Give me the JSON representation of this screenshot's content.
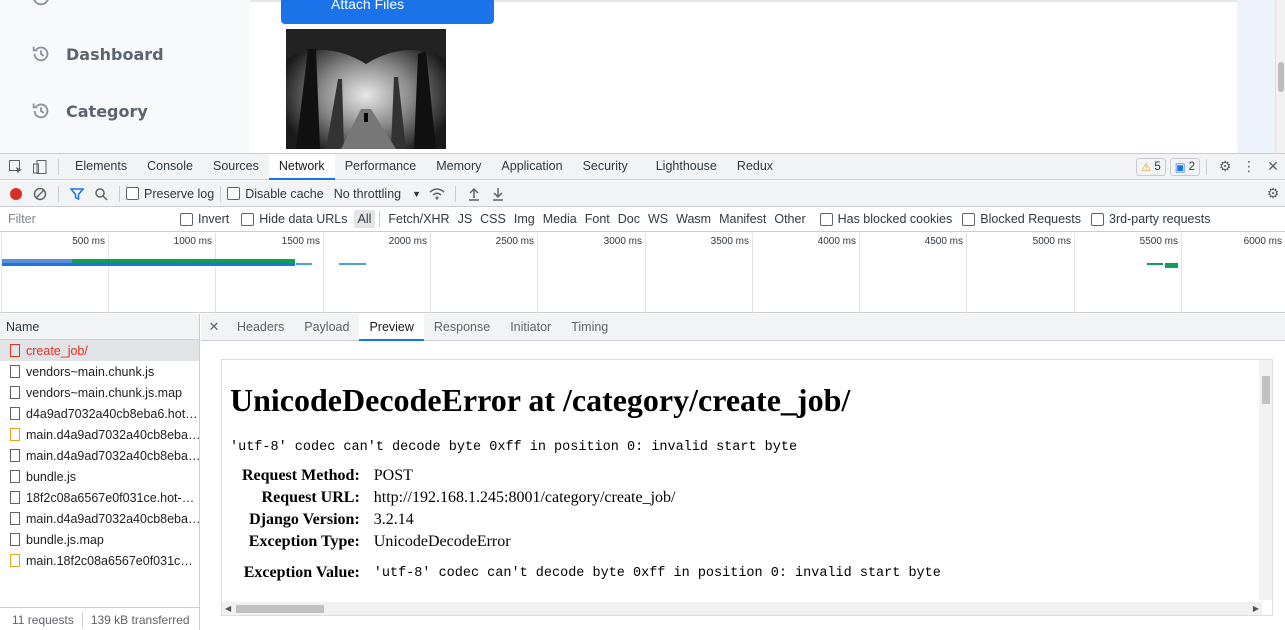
{
  "app": {
    "sidebar": [
      {
        "label": "Dashboard",
        "icon": "history-icon"
      },
      {
        "label": "Category",
        "icon": "history-icon"
      }
    ],
    "attach_label": "Attach Files"
  },
  "devtools": {
    "tabs": [
      "Elements",
      "Console",
      "Sources",
      "Network",
      "Performance",
      "Memory",
      "Application",
      "Security",
      "Lighthouse",
      "Redux"
    ],
    "active_tab": "Network",
    "warnings_count": "5",
    "messages_count": "2",
    "toolbar": {
      "preserve_log": "Preserve log",
      "disable_cache": "Disable cache",
      "throttling": "No throttling"
    },
    "filterbar": {
      "placeholder": "Filter",
      "invert": "Invert",
      "hide_data_urls": "Hide data URLs",
      "types": [
        "All",
        "Fetch/XHR",
        "JS",
        "CSS",
        "Img",
        "Media",
        "Font",
        "Doc",
        "WS",
        "Wasm",
        "Manifest",
        "Other"
      ],
      "blocked_cookies": "Has blocked cookies",
      "blocked_requests": "Blocked Requests",
      "third_party": "3rd-party requests"
    },
    "timeline_ticks": [
      "500 ms",
      "1000 ms",
      "1500 ms",
      "2000 ms",
      "2500 ms",
      "3000 ms",
      "3500 ms",
      "4000 ms",
      "4500 ms",
      "5000 ms",
      "5500 ms",
      "6000 ms"
    ],
    "name_header": "Name",
    "requests": [
      {
        "name": "create_job/",
        "kind": "error"
      },
      {
        "name": "vendors~main.chunk.js",
        "kind": "doc"
      },
      {
        "name": "vendors~main.chunk.js.map",
        "kind": "doc"
      },
      {
        "name": "d4a9ad7032a40cb8eba6.hot…",
        "kind": "doc"
      },
      {
        "name": "main.d4a9ad7032a40cb8eba…",
        "kind": "js"
      },
      {
        "name": "main.d4a9ad7032a40cb8eba…",
        "kind": "doc"
      },
      {
        "name": "bundle.js",
        "kind": "doc"
      },
      {
        "name": "18f2c08a6567e0f031ce.hot-…",
        "kind": "doc"
      },
      {
        "name": "main.d4a9ad7032a40cb8eba…",
        "kind": "doc"
      },
      {
        "name": "bundle.js.map",
        "kind": "doc"
      },
      {
        "name": "main.18f2c08a6567e0f031c…",
        "kind": "js"
      }
    ],
    "status": {
      "requests": "11 requests",
      "transferred": "139 kB transferred"
    },
    "detail_tabs": [
      "Headers",
      "Payload",
      "Preview",
      "Response",
      "Initiator",
      "Timing"
    ],
    "active_detail_tab": "Preview",
    "preview": {
      "title": "UnicodeDecodeError at /category/create_job/",
      "message": "'utf-8' codec can't decode byte 0xff in position 0: invalid start byte",
      "rows": [
        {
          "label": "Request Method:",
          "value": "POST"
        },
        {
          "label": "Request URL:",
          "value": "http://192.168.1.245:8001/category/create_job/"
        },
        {
          "label": "Django Version:",
          "value": "3.2.14"
        },
        {
          "label": "Exception Type:",
          "value": "UnicodeDecodeError"
        },
        {
          "label": "Exception Value:",
          "value": "'utf-8' codec can't decode byte 0xff in position 0: invalid start byte"
        }
      ]
    }
  }
}
